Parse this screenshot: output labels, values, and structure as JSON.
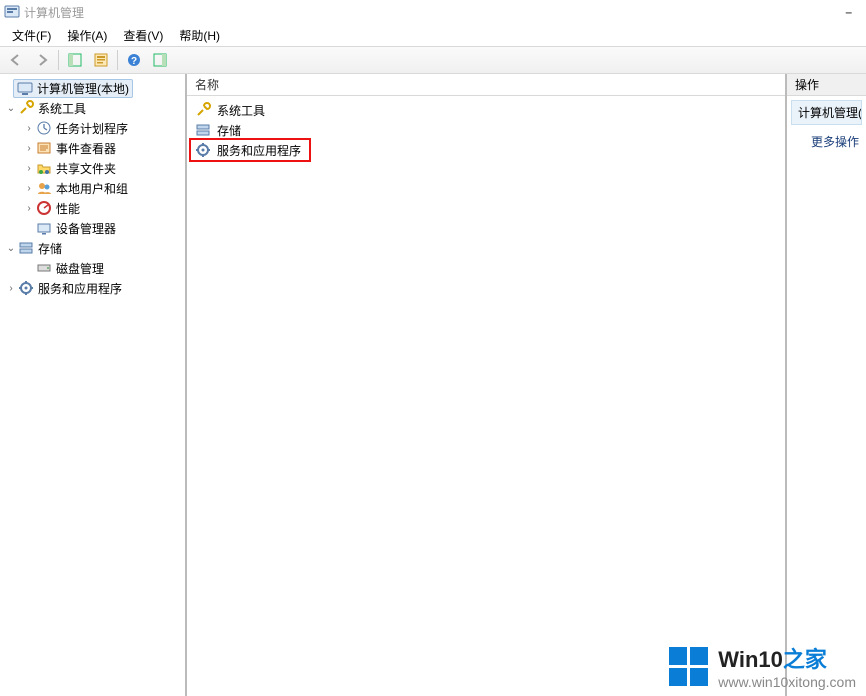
{
  "title": "计算机管理",
  "menus": {
    "file": "文件(F)",
    "action": "操作(A)",
    "view": "查看(V)",
    "help": "帮助(H)"
  },
  "tree": {
    "root": "计算机管理(本地)",
    "system_tools": "系统工具",
    "task_scheduler": "任务计划程序",
    "event_viewer": "事件查看器",
    "shared_folders": "共享文件夹",
    "local_users": "本地用户和组",
    "performance": "性能",
    "device_manager": "设备管理器",
    "storage": "存储",
    "disk_management": "磁盘管理",
    "services_apps": "服务和应用程序"
  },
  "list": {
    "column_name": "名称",
    "items": {
      "system_tools": "系统工具",
      "storage": "存储",
      "services_apps": "服务和应用程序"
    }
  },
  "actions": {
    "header": "操作",
    "group_title": "计算机管理(本地)",
    "more": "更多操作"
  },
  "watermark": {
    "brand_part1": "Win10",
    "brand_part2": "之家",
    "url": "www.win10xitong.com"
  }
}
